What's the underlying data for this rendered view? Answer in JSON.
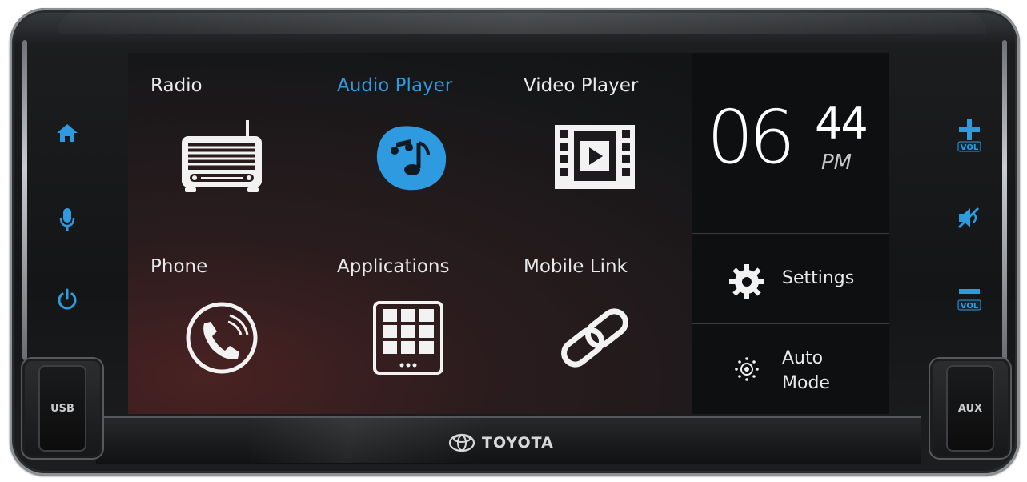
{
  "brand": {
    "name": "TOYOTA"
  },
  "left_keys": [
    {
      "icon": "home-icon"
    },
    {
      "icon": "microphone-icon"
    },
    {
      "icon": "power-icon"
    }
  ],
  "right_keys": [
    {
      "icon": "volume-up-icon",
      "label": "VOL"
    },
    {
      "icon": "mute-icon"
    },
    {
      "icon": "volume-down-icon",
      "label": "VOL"
    }
  ],
  "ports": {
    "left": "USB",
    "right": "AUX"
  },
  "tiles": [
    {
      "label": "Radio",
      "icon": "radio-icon",
      "active": false
    },
    {
      "label": "Audio Player",
      "icon": "music-note-icon",
      "active": true
    },
    {
      "label": "Video Player",
      "icon": "film-play-icon",
      "active": false
    },
    {
      "label": "Phone",
      "icon": "phone-icon",
      "active": false
    },
    {
      "label": "Applications",
      "icon": "apps-grid-icon",
      "active": false
    },
    {
      "label": "Mobile Link",
      "icon": "link-icon",
      "active": false
    }
  ],
  "clock": {
    "hours": "06",
    "minutes": "44",
    "ampm": "PM"
  },
  "panel": {
    "settings_label": "Settings",
    "auto_mode_line1": "Auto",
    "auto_mode_line2": "Mode"
  },
  "colors": {
    "accent": "#2e9be0",
    "text": "#e9eaeb",
    "panel_bg": "#0e0f10"
  }
}
